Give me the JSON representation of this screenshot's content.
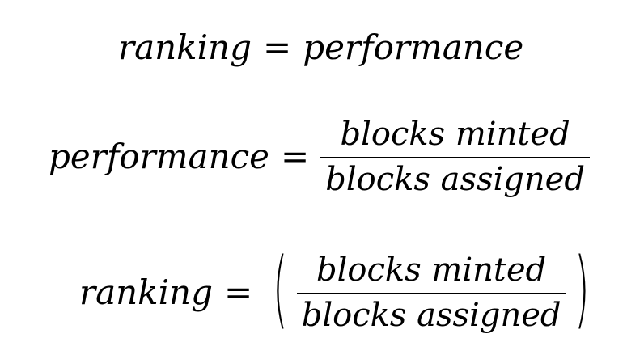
{
  "equations": [
    {
      "lhs": "ranking",
      "op": "=",
      "rhs": "performance"
    },
    {
      "lhs": "performance",
      "op": "=",
      "numerator": "blocks minted",
      "denominator": "blocks assigned"
    },
    {
      "lhs": "ranking",
      "op": "=",
      "open_paren": "(",
      "numerator": "blocks minted",
      "denominator": "blocks assigned",
      "close_paren": ")"
    }
  ]
}
